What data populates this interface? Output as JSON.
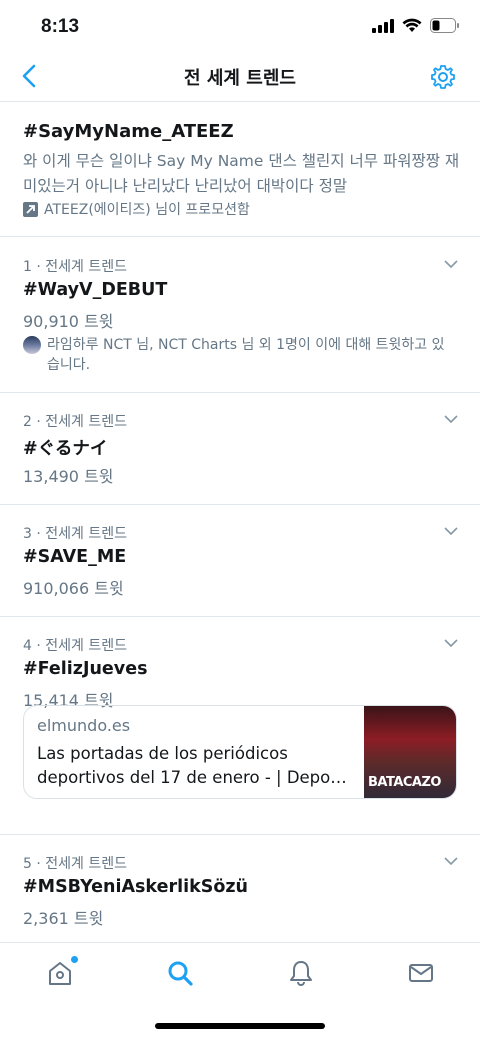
{
  "status_bar": {
    "time": "8:13"
  },
  "nav": {
    "title": "전 세계 트렌드"
  },
  "promoted": {
    "hashtag": "#SayMyName_ATEEZ",
    "description": "와 이게 무슨 일이냐 Say My Name  댄스 챌린지 너무 파워짱짱 재미있는거 아니냐 난리났다 난리났어 대박이다 정말",
    "promoted_by": "ATEEZ(에이티즈) 님이 프로모션함"
  },
  "trends": [
    {
      "rank": "1 · 전세계 트렌드",
      "name": "#WayV_DEBUT",
      "count": "90,910 트윗",
      "context": "라임하루 NCT 님, NCT Charts 님 외 1명이 이에 대해 트윗하고 있습니다."
    },
    {
      "rank": "2 · 전세계 트렌드",
      "name": "#ぐるナイ",
      "count": "13,490 트윗"
    },
    {
      "rank": "3 · 전세계 트렌드",
      "name": "#SAVE_ME",
      "count": "910,066 트윗"
    },
    {
      "rank": "4 · 전세계 트렌드",
      "name": "#FelizJueves",
      "count": "15,414 트윗",
      "card": {
        "domain": "elmundo.es",
        "title_line1": "Las portadas de los periódicos",
        "title_line2": "deportivos del 17 de enero - | Depo…",
        "thumb_text": "BATACAZO"
      }
    },
    {
      "rank": "5 · 전세계 트렌드",
      "name": "#MSBYeniAskerlikSözü",
      "count": "2,361 트윗"
    }
  ],
  "colors": {
    "accent": "#1da1f2",
    "secondary_text": "#657786",
    "divider": "#e1e8ed"
  },
  "tabs": [
    {
      "icon": "home-icon"
    },
    {
      "icon": "search-icon",
      "active": true
    },
    {
      "icon": "notifications-icon"
    },
    {
      "icon": "messages-icon"
    }
  ]
}
